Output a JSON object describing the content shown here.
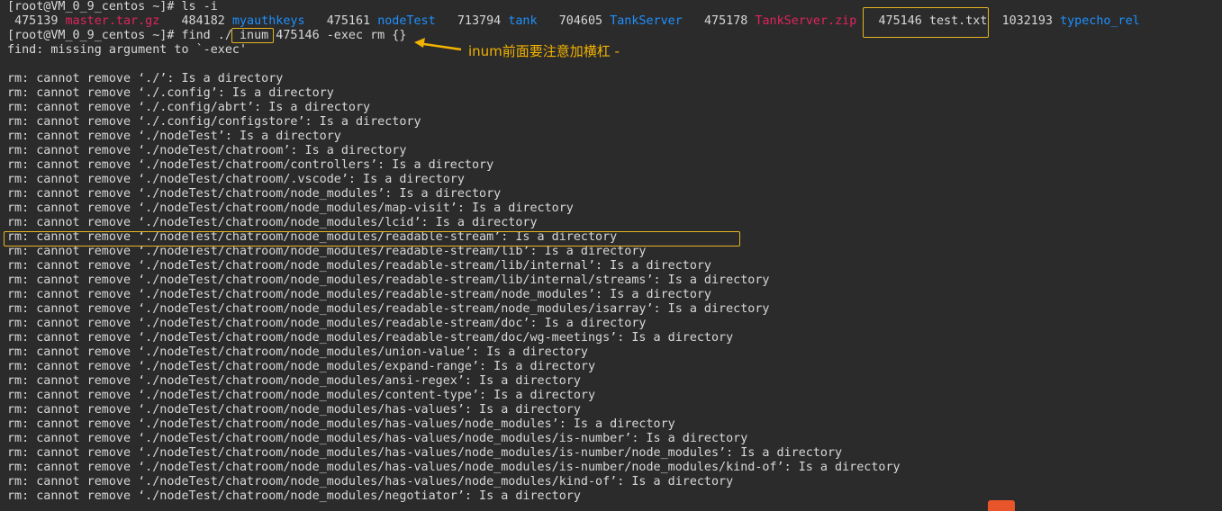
{
  "ls_command": "[root@VM_0_9_centos ~]# ls -i",
  "ls_output": {
    "i1": "475139",
    "f1": "master.tar.gz",
    "i2": "484182",
    "f2": "myauthkeys",
    "i3": "475161",
    "f3": "nodeTest",
    "i4": "713794",
    "f4": "tank",
    "i5": "704605",
    "f5": "TankServer",
    "i6": "475178",
    "f6": "TankServer.zip",
    "i7": "475146",
    "f7": "test.txt",
    "i8": "1032193",
    "f8": "typecho_rel"
  },
  "find_command": {
    "prompt": "[root@VM_0_9_centos ~]# find ./ ",
    "boxed": "inum",
    "rest": "475146 -exec rm {}"
  },
  "annotation": "inum前面要注意加横杠 -",
  "find_error": "find: missing argument to `-exec'",
  "rm_lines": [
    "rm: cannot remove ‘./’: Is a directory",
    "rm: cannot remove ‘./.config’: Is a directory",
    "rm: cannot remove ‘./.config/abrt’: Is a directory",
    "rm: cannot remove ‘./.config/configstore’: Is a directory",
    "rm: cannot remove ‘./nodeTest’: Is a directory",
    "rm: cannot remove ‘./nodeTest/chatroom’: Is a directory",
    "rm: cannot remove ‘./nodeTest/chatroom/controllers’: Is a directory",
    "rm: cannot remove ‘./nodeTest/chatroom/.vscode’: Is a directory",
    "rm: cannot remove ‘./nodeTest/chatroom/node_modules’: Is a directory",
    "rm: cannot remove ‘./nodeTest/chatroom/node_modules/map-visit’: Is a directory",
    "rm: cannot remove ‘./nodeTest/chatroom/node_modules/lcid’: Is a directory",
    "rm: cannot remove ‘./nodeTest/chatroom/node_modules/readable-stream’: Is a directory",
    "rm: cannot remove ‘./nodeTest/chatroom/node_modules/readable-stream/lib’: Is a directory",
    "rm: cannot remove ‘./nodeTest/chatroom/node_modules/readable-stream/lib/internal’: Is a directory",
    "rm: cannot remove ‘./nodeTest/chatroom/node_modules/readable-stream/lib/internal/streams’: Is a directory",
    "rm: cannot remove ‘./nodeTest/chatroom/node_modules/readable-stream/node_modules’: Is a directory",
    "rm: cannot remove ‘./nodeTest/chatroom/node_modules/readable-stream/node_modules/isarray’: Is a directory",
    "rm: cannot remove ‘./nodeTest/chatroom/node_modules/readable-stream/doc’: Is a directory",
    "rm: cannot remove ‘./nodeTest/chatroom/node_modules/readable-stream/doc/wg-meetings’: Is a directory",
    "rm: cannot remove ‘./nodeTest/chatroom/node_modules/union-value’: Is a directory",
    "rm: cannot remove ‘./nodeTest/chatroom/node_modules/expand-range’: Is a directory",
    "rm: cannot remove ‘./nodeTest/chatroom/node_modules/ansi-regex’: Is a directory",
    "rm: cannot remove ‘./nodeTest/chatroom/node_modules/content-type’: Is a directory",
    "rm: cannot remove ‘./nodeTest/chatroom/node_modules/has-values’: Is a directory",
    "rm: cannot remove ‘./nodeTest/chatroom/node_modules/has-values/node_modules’: Is a directory",
    "rm: cannot remove ‘./nodeTest/chatroom/node_modules/has-values/node_modules/is-number’: Is a directory",
    "rm: cannot remove ‘./nodeTest/chatroom/node_modules/has-values/node_modules/is-number/node_modules’: Is a directory",
    "rm: cannot remove ‘./nodeTest/chatroom/node_modules/has-values/node_modules/is-number/node_modules/kind-of’: Is a directory",
    "rm: cannot remove ‘./nodeTest/chatroom/node_modules/has-values/node_modules/kind-of’: Is a directory",
    "rm: cannot remove ‘./nodeTest/chatroom/node_modules/negotiator’: Is a directory"
  ],
  "colors": {
    "background": "#2b2b2b",
    "text": "#d8d8d8",
    "archive_file": "#e0245e",
    "directory": "#1e90ff",
    "highlight_box": "#e6b422",
    "annotation": "#f2b200"
  }
}
